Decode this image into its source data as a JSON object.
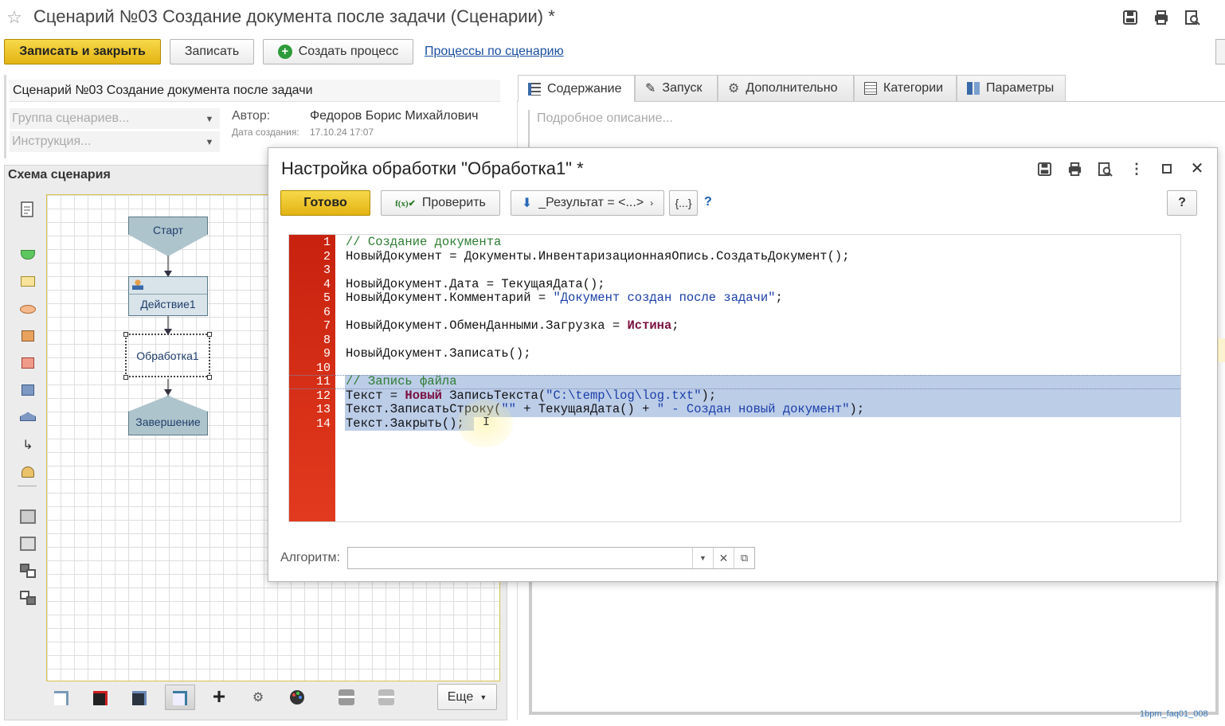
{
  "window": {
    "title": "Сценарий №03 Создание документа после задачи (Сценарии) *"
  },
  "toolbar": {
    "save_close": "Записать и закрыть",
    "save": "Записать",
    "create_process": "Создать процесс",
    "processes_link": "Процессы по сценарию"
  },
  "form": {
    "name_value": "Сценарий №03 Создание документа после задачи",
    "group_placeholder": "Группа сценариев...",
    "instruction_placeholder": "Инструкция...",
    "author_label": "Автор:",
    "author_value": "Федоров Борис Михайлович",
    "created_label": "Дата создания:",
    "created_value": "17.10.24 17:07"
  },
  "schema": {
    "title": "Схема сценария",
    "start": "Старт",
    "action": "Действие1",
    "processing": "Обработка1",
    "end": "Завершение",
    "more_label": "Еще"
  },
  "tabs": [
    {
      "label": "Содержание"
    },
    {
      "label": "Запуск"
    },
    {
      "label": "Дополнительно"
    },
    {
      "label": "Категории"
    },
    {
      "label": "Параметры"
    }
  ],
  "content": {
    "description_placeholder": "Подробное описание..."
  },
  "dialog": {
    "title": "Настройка обработки \"Обработка1\" *",
    "ready": "Готово",
    "check": "Проверить",
    "result": "_Результат = <...>",
    "braces": "{...}",
    "help_q": "?",
    "help_btn": "?",
    "algorithm_label": "Алгоритм:",
    "algorithm_value": ""
  },
  "code": {
    "lines": [
      [
        {
          "t": "// Создание документа",
          "c": "cm"
        }
      ],
      [
        {
          "t": "НовыйДокумент = Документы.ИнвентаризационнаяОпись.СоздатьДокумент();",
          "c": ""
        }
      ],
      [
        {
          "t": "",
          "c": ""
        }
      ],
      [
        {
          "t": "НовыйДокумент.Дата = ТекущаяДата();",
          "c": ""
        }
      ],
      [
        {
          "t": "НовыйДокумент.Комментарий = ",
          "c": ""
        },
        {
          "t": "\"Документ создан после задачи\"",
          "c": "st"
        },
        {
          "t": ";",
          "c": ""
        }
      ],
      [
        {
          "t": "",
          "c": ""
        }
      ],
      [
        {
          "t": "НовыйДокумент.ОбменДанными.Загрузка = ",
          "c": ""
        },
        {
          "t": "Истина",
          "c": "kw"
        },
        {
          "t": ";",
          "c": ""
        }
      ],
      [
        {
          "t": "",
          "c": ""
        }
      ],
      [
        {
          "t": "НовыйДокумент.Записать();",
          "c": ""
        }
      ],
      [
        {
          "t": "",
          "c": ""
        }
      ],
      [
        {
          "t": "// Запись файла",
          "c": "cm"
        }
      ],
      [
        {
          "t": "Текст = ",
          "c": ""
        },
        {
          "t": "Новый",
          "c": "kw"
        },
        {
          "t": " ЗаписьТекста(",
          "c": ""
        },
        {
          "t": "\"C:\\temp\\log\\log.txt\"",
          "c": "st"
        },
        {
          "t": ");",
          "c": ""
        }
      ],
      [
        {
          "t": "Текст.ЗаписатьСтроку(",
          "c": ""
        },
        {
          "t": "\"\"",
          "c": "st"
        },
        {
          "t": " + ТекущаяДата() + ",
          "c": ""
        },
        {
          "t": "\" - Создан новый документ\"",
          "c": "st"
        },
        {
          "t": ");",
          "c": ""
        }
      ],
      [
        {
          "t": "Текст.Закрыть();",
          "c": ""
        }
      ]
    ]
  },
  "footer": {
    "watermark": "1bpm_faq01_008"
  }
}
